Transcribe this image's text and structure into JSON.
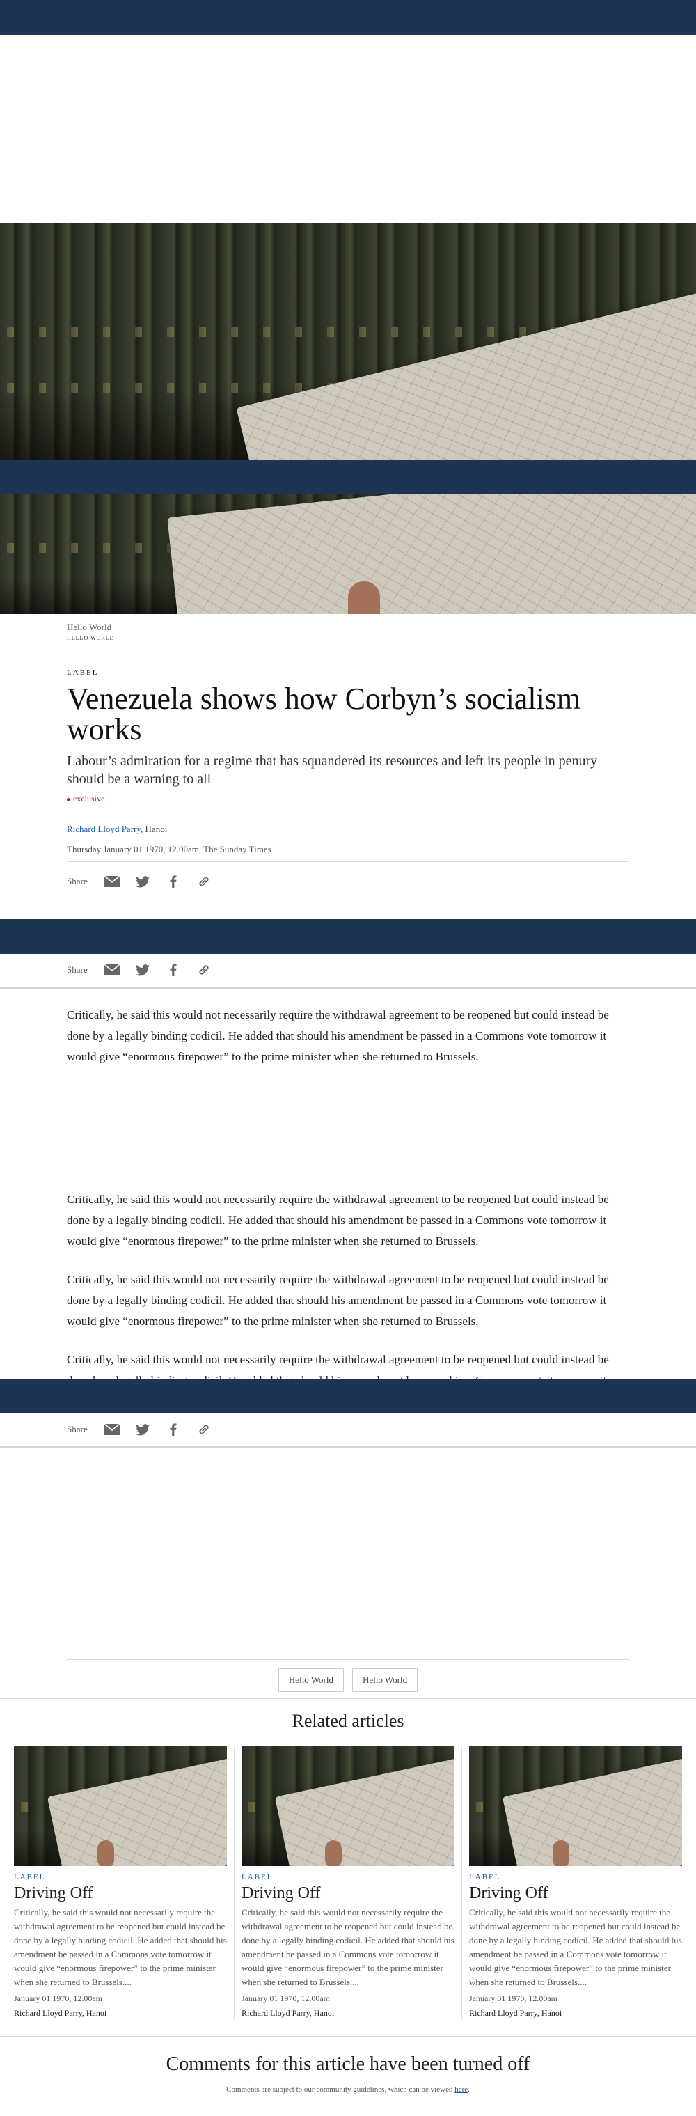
{
  "header": {
    "kicker": "Hello World",
    "kicker_sub": "HELLO WORLD"
  },
  "article": {
    "label": "LABEL",
    "headline": "Venezuela shows how Corbyn’s socialism works",
    "standfirst": "Labour’s admiration for a regime that has squandered its resources and left its people in penury should be a warning to all",
    "exclusive": "exclusive",
    "author": "Richard Lloyd Parry",
    "location": ", Hanoi",
    "dateline": "Thursday January 01 1970, 12.00am, The Sunday Times",
    "paragraphs": [
      "Critically, he said this would not necessarily require the withdrawal agreement to be reopened but could instead be done by a legally binding codicil. He added that should his amendment be passed in a Commons vote tomorrow it would give “enormous firepower” to the prime minister when she returned to Brussels.",
      "Critically, he said this would not necessarily require the withdrawal agreement to be reopened but could instead be done by a legally binding codicil. He added that should his amendment be passed in a Commons vote tomorrow it would give “enormous firepower” to the prime minister when she returned to Brussels.",
      "Critically, he said this would not necessarily require the withdrawal agreement to be reopened but could instead be done by a legally binding codicil. He added that should his amendment be passed in a Commons vote tomorrow it would give “enormous firepower” to the prime minister when she returned to Brussels.",
      "Critically, he said this would not necessarily require the withdrawal agreement to be reopened but could instead be done by a legally binding codicil. He added that should his amendment be passed in a Commons vote tomorrow it would give “enormous firepower” to the prime minister when she returned to Brussels."
    ]
  },
  "share": {
    "label": "Share",
    "icons": [
      "email-icon",
      "twitter-icon",
      "facebook-icon",
      "link-icon"
    ]
  },
  "tags": [
    "Hello World",
    "Hello World"
  ],
  "related": {
    "title": "Related articles",
    "cards": [
      {
        "label": "LABEL",
        "title": "Driving Off",
        "text": "Critically, he said this would not necessarily require the withdrawal agreement to be reopened but could instead be done by a legally binding codicil. He added that should his amendment be passed in a Commons vote tomorrow it would give “enormous firepower” to the prime minister when she returned to Brussels....",
        "date": "January 01 1970, 12.00am",
        "author": "Richard Lloyd Parry, Hanoi"
      },
      {
        "label": "LABEL",
        "title": "Driving Off",
        "text": "Critically, he said this would not necessarily require the withdrawal agreement to be reopened but could instead be done by a legally binding codicil. He added that should his amendment be passed in a Commons vote tomorrow it would give “enormous firepower” to the prime minister when she returned to Brussels....",
        "date": "January 01 1970, 12.00am",
        "author": "Richard Lloyd Parry, Hanoi"
      },
      {
        "label": "LABEL",
        "title": "Driving Off",
        "text": "Critically, he said this would not necessarily require the withdrawal agreement to be reopened but could instead be done by a legally binding codicil. He added that should his amendment be passed in a Commons vote tomorrow it would give “enormous firepower” to the prime minister when she returned to Brussels....",
        "date": "January 01 1970, 12.00am",
        "author": "Richard Lloyd Parry, Hanoi"
      }
    ]
  },
  "comments": {
    "title": "Comments for this article have been turned off",
    "note_prefix": "Comments are subject to our community guidelines, which can be viewed ",
    "note_link": "here",
    "note_suffix": "."
  },
  "colors": {
    "navy": "#1d3552",
    "link": "#1e5ea8",
    "exclusive": "#c8102e"
  }
}
